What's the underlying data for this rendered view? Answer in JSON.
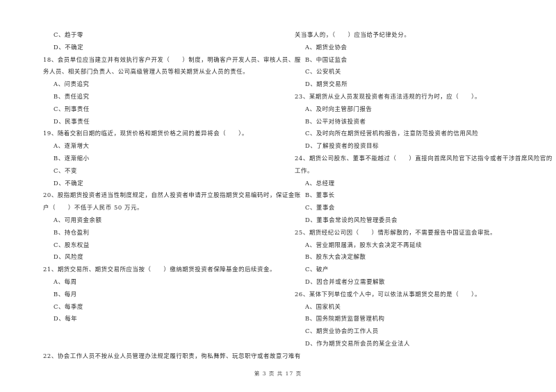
{
  "page": {
    "footer": "第 3 页 共 17 页"
  },
  "left_column": {
    "q17_tail": {
      "options": [
        "C、趋于零",
        "D、不确定"
      ]
    },
    "q18": {
      "lines": [
        "18、会员单位应当建立并有效执行客户开发（　　）制度，明确客户开发人员、审核人员、服",
        "务人员、相关部门负责人、公司高级管理人员等相关期货从业人员的责任。"
      ],
      "options": [
        "A、问责追究",
        "B、责任追究",
        "C、刑事责任",
        "D、民事责任"
      ]
    },
    "q19": {
      "lines": [
        "19、随着交割日期的临近，现货价格和期货价格之间的差异将会（　　）。"
      ],
      "options": [
        "A、逐渐增大",
        "B、逐渐缩小",
        "C、不变",
        "D、不确定"
      ]
    },
    "q20": {
      "lines": [
        "20、股指期货投资者适当性制度规定，自然人投资者申请开立股指期货交易编码时，保证金账",
        "户（　　）不低于人民币 50 万元。"
      ],
      "options": [
        "A、可用资金余额",
        "B、持仓盈利",
        "C、股东权益",
        "D、风险度"
      ]
    },
    "q21": {
      "lines": [
        "21、期货交易所、期货交易所应当按（　　）缴纳期货投资者保障基金的后续资金。"
      ],
      "options": [
        "A、每周",
        "B、每月",
        "C、每季度",
        "D、每年"
      ]
    },
    "q22": {
      "lines": [
        "22、协会工作人员不按从业人员管理办法规定履行职责，徇私舞弊、玩忽职守或者故意刁难有"
      ]
    }
  },
  "right_column": {
    "q22_tail": {
      "lines": [
        "关当事人的，（　　）应当给予纪律处分。"
      ],
      "options": [
        "A、期货业协会",
        "B、中国证监会",
        "C、公安机关",
        "D、期货交易所"
      ]
    },
    "q23": {
      "lines": [
        "23、某期货从业人员发现投资者有违法违规的行为时，应（　　）。"
      ],
      "options": [
        "A、及时向主管部门报告",
        "B、公平对待该投资者",
        "C、及时向所在期货经营机构报告，注意防范投资者的信用风险",
        "D、了解投资者的投资目标"
      ]
    },
    "q24": {
      "lines": [
        "24、期货公司股东、董事不能越过（　　）直接向首席风险官下达指令或者干涉首席风险官的",
        "工作。"
      ],
      "options": [
        "A、总经理",
        "B、董事长",
        "C、董事会",
        "D、董事会常设的风险管理委员会"
      ]
    },
    "q25": {
      "lines": [
        "25、期货经纪公司因（　　）情形解散的，不需要报告中国证监会审批。"
      ],
      "options": [
        "A、营业期限届满，股东大会决定不再延续",
        "B、股东大会决定解散",
        "C、破产",
        "D、因合并或者分立需要解散"
      ]
    },
    "q26": {
      "lines": [
        "26、某体下列单位或个人中，可以依法从事期货交易的是（　　）。"
      ],
      "options": [
        "A、国家机关",
        "B、国务院期货监督管理机构",
        "C、期货业协会的工作人员",
        "D、作为期货交易所会员的某企业法人"
      ]
    }
  }
}
